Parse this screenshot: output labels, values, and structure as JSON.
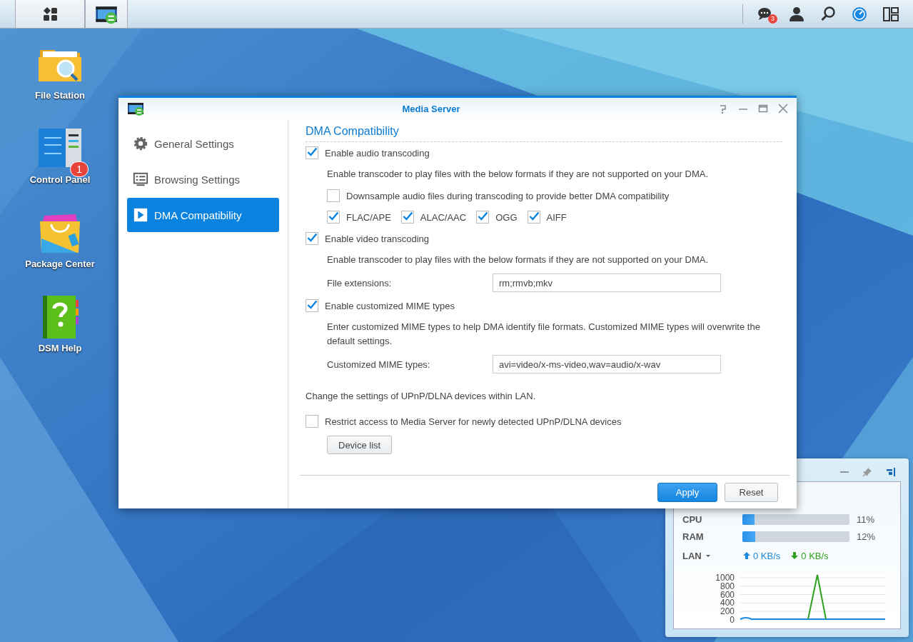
{
  "taskbar": {
    "buttons": [
      {
        "kind": "main-menu"
      },
      {
        "kind": "media-server"
      }
    ],
    "tray": [
      {
        "kind": "messages",
        "badge": "3"
      },
      {
        "kind": "user"
      },
      {
        "kind": "search"
      },
      {
        "kind": "gauge"
      },
      {
        "kind": "widgets"
      }
    ]
  },
  "desktop_icons": [
    {
      "kind": "file-station",
      "label": "File Station"
    },
    {
      "kind": "control-panel",
      "label": "Control Panel",
      "badge": "1"
    },
    {
      "kind": "package-center",
      "label": "Package Center"
    },
    {
      "kind": "help",
      "label": "DSM Help"
    }
  ],
  "window": {
    "title": "Media Server",
    "sidebar": [
      {
        "kind": "gear",
        "label": "General Settings",
        "selected": false
      },
      {
        "kind": "list",
        "label": "Browsing Settings",
        "selected": false
      },
      {
        "kind": "play",
        "label": "DMA Compatibility",
        "selected": true
      }
    ],
    "heading": "DMA Compatibility",
    "rows": [
      {
        "kind": "checkbox",
        "label": "Enable audio transcoding",
        "checked": true
      },
      {
        "kind": "note",
        "text": "Enable transcoder to play files with the below formats if they are not supported on your DMA."
      },
      {
        "kind": "sub-checkbox",
        "label": "Downsample audio files during transcoding to provide better DMA compatibility",
        "checked": false
      },
      {
        "kind": "checks",
        "items": [
          {
            "label": "FLAC/APE",
            "checked": true
          },
          {
            "label": "ALAC/AAC",
            "checked": true
          },
          {
            "label": "OGG",
            "checked": true
          },
          {
            "label": "AIFF",
            "checked": true
          }
        ]
      },
      {
        "kind": "checkbox",
        "label": "Enable video transcoding",
        "checked": true
      },
      {
        "kind": "note",
        "text": "Enable transcoder to play files with the below formats if they are not supported on your DMA."
      },
      {
        "kind": "field",
        "label": "File extensions:",
        "value": "rm;rmvb;mkv"
      },
      {
        "kind": "checkbox",
        "label": "Enable customized MIME types",
        "checked": true
      },
      {
        "kind": "note",
        "text": "Enter customized MIME types to help DMA identify file formats. Customized MIME types will overwrite the default settings."
      },
      {
        "kind": "field",
        "label": "Customized MIME types:",
        "value": "avi=video/x-ms-video,wav=audio/x-wav"
      },
      {
        "kind": "text",
        "text": "Change the settings of UPnP/DLNA devices within LAN."
      },
      {
        "kind": "checkbox",
        "label": "Restrict access to Media Server for newly detected UPnP/DLNA devices",
        "checked": false
      },
      {
        "kind": "button",
        "label": "Device list"
      }
    ],
    "buttons": [
      {
        "kind": "primary",
        "label": "Apply"
      },
      {
        "kind": "secondary",
        "label": "Reset"
      }
    ]
  },
  "monitor": {
    "stats": [
      {
        "label": "CPU",
        "level": 0.11,
        "reading": "11%"
      },
      {
        "label": "RAM",
        "level": 0.12,
        "reading": "12%"
      }
    ],
    "lan": {
      "label": "LAN",
      "upload": "0 KB/s",
      "download": "0 KB/s",
      "axis_labels": [
        "1000",
        "800",
        "600",
        "400",
        "200",
        "0"
      ]
    }
  }
}
